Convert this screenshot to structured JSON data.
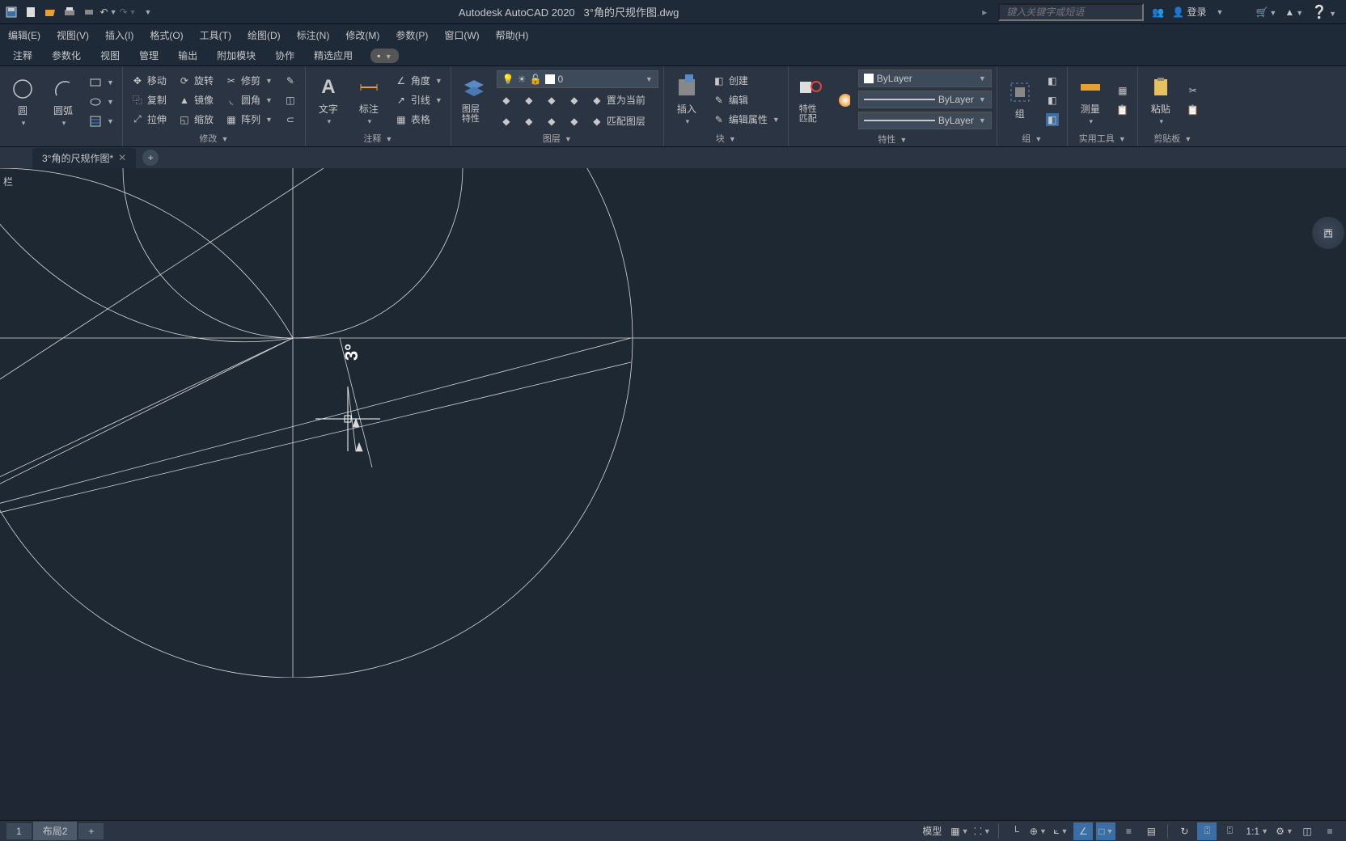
{
  "app_title": "Autodesk AutoCAD 2020",
  "file_name": "3°角的尺规作图.dwg",
  "search_placeholder": "键入关键字或短语",
  "login_label": "登录",
  "menu": [
    "编辑(E)",
    "视图(V)",
    "插入(I)",
    "格式(O)",
    "工具(T)",
    "绘图(D)",
    "标注(N)",
    "修改(M)",
    "参数(P)",
    "窗口(W)",
    "帮助(H)"
  ],
  "tabs": [
    "注释",
    "参数化",
    "视图",
    "管理",
    "输出",
    "附加模块",
    "协作",
    "精选应用"
  ],
  "doctab": "3°角的尺规作图*",
  "draw": {
    "circle": "圆",
    "arc": "圆弧"
  },
  "modify": {
    "move": "移动",
    "rotate": "旋转",
    "trim": "修剪",
    "copy": "复制",
    "mirror": "镜像",
    "fillet": "圆角",
    "stretch": "拉伸",
    "scale": "缩放",
    "array": "阵列",
    "label": "修改"
  },
  "annot": {
    "text": "文字",
    "dim": "标注",
    "angle": "角度",
    "leader": "引线",
    "table": "表格",
    "label": "注释"
  },
  "layer": {
    "panel_btn": "图层特性",
    "current": "0",
    "set_current": "置为当前",
    "match": "匹配图层",
    "label": "图层"
  },
  "block": {
    "insert": "插入",
    "create": "创建",
    "edit": "编辑",
    "edit_attr": "编辑属性",
    "label": "块"
  },
  "props": {
    "panel_btn": "特性匹配",
    "bylayer": "ByLayer",
    "label": "特性"
  },
  "group": {
    "btn": "组",
    "label": "组"
  },
  "utils": {
    "measure": "测量",
    "label": "实用工具"
  },
  "clipboard": {
    "paste": "粘贴",
    "label": "剪贴板"
  },
  "angle_annotation": "3°",
  "viewcube_e": "西",
  "leftchar": "栏",
  "layouts": {
    "l1": "1",
    "l2": "布局2"
  },
  "status": {
    "model": "模型",
    "scale": "1:1"
  }
}
